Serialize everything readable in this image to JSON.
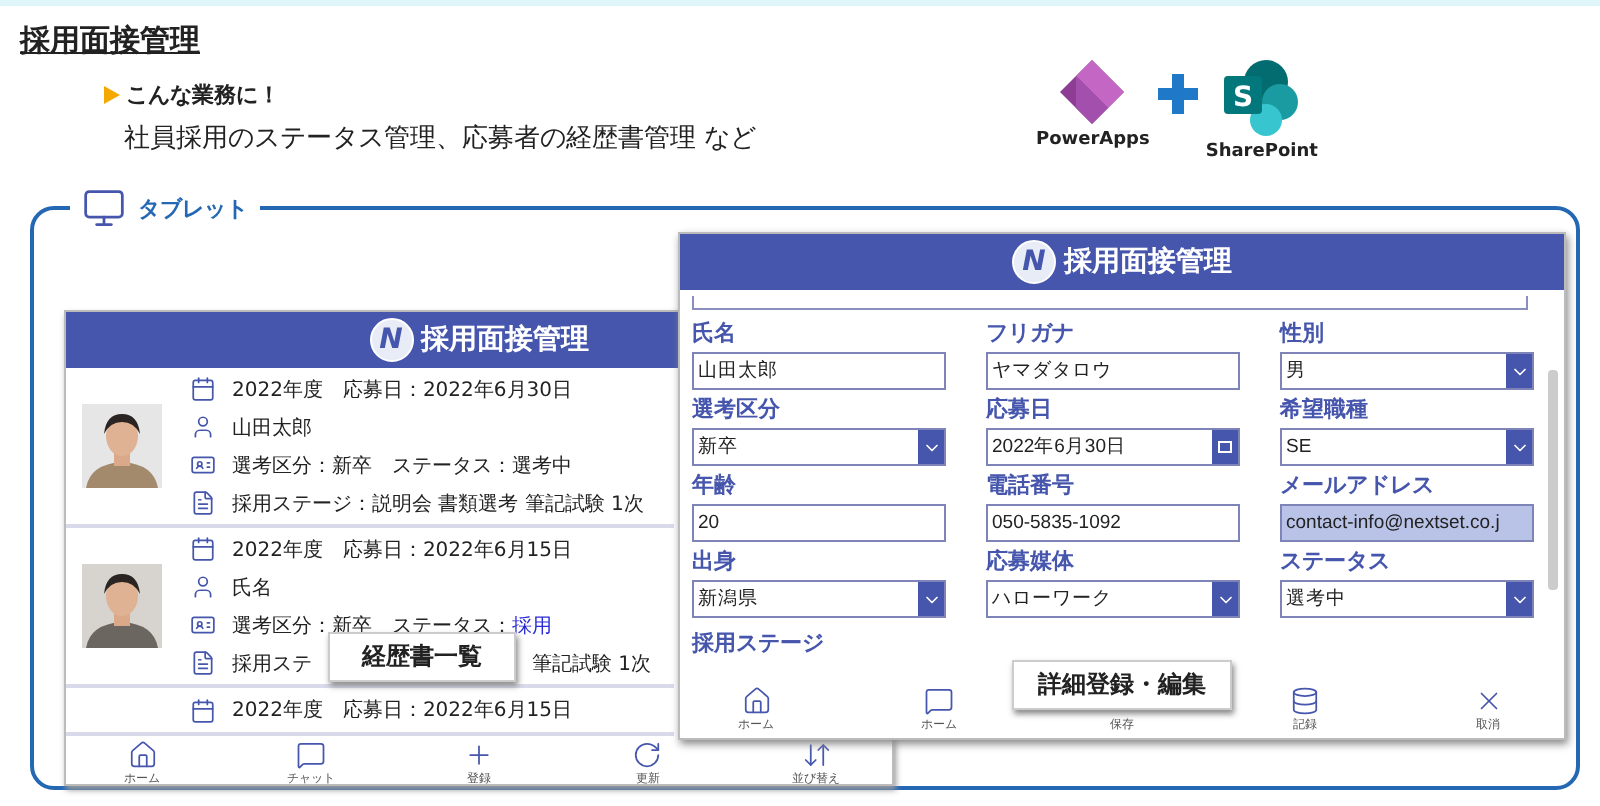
{
  "title": "採用面接管理",
  "intro": {
    "heading": "こんな業務に！",
    "text": "社員採用のステータス管理、応募者の経歴書管理 など"
  },
  "logos": [
    {
      "name": "PowerApps",
      "kind": "powerapps"
    },
    {
      "name": "SharePoint",
      "kind": "sharepoint",
      "letter": "S"
    }
  ],
  "section": {
    "label": "タブレット"
  },
  "list_screen": {
    "logo_letter": "N",
    "title": "採用面接管理",
    "callout": "経歴書一覧",
    "rows": [
      {
        "photo": {
          "kind": "picture"
        },
        "year": "2022年度　応募日：2022年6月30日",
        "name": "山田太郎",
        "category": "選考区分：新卒　ステータス：",
        "status": "選考中",
        "color": "#222222",
        "stage": [
          "採用ステージ：説明会 書類選考 筆記試験 1次"
        ]
      },
      {
        "photo": {
          "kind": "picture"
        },
        "year": "2022年度　応募日：2022年6月15日",
        "name": "氏名",
        "category": "選考区分：新卒　ステータス：",
        "status": "採用",
        "color": "#2b2bd6",
        "stage": [
          "採用ステ",
          "筆記試験 1次"
        ]
      },
      {
        "year": "2022年度　応募日：2022年6月15日"
      }
    ],
    "nav": [
      {
        "label": "ホーム",
        "kind": "home"
      },
      {
        "label": "チャット",
        "kind": "chat"
      },
      {
        "label": "登録",
        "kind": "plus"
      },
      {
        "label": "更新",
        "kind": "refresh"
      },
      {
        "label": "並び替え",
        "kind": "sort"
      }
    ]
  },
  "detail_screen": {
    "logo_letter": "N",
    "title": "採用面接管理",
    "callout": "詳細登録・編集",
    "stage_label": "採用ステージ",
    "fields": [
      {
        "label": "氏名",
        "value": "山田太郎",
        "kind": "text",
        "highlighted": false
      },
      {
        "label": "フリガナ",
        "value": "ヤマダタロウ",
        "kind": "text",
        "highlighted": false
      },
      {
        "label": "性別",
        "value": "男",
        "kind": "select",
        "highlighted": false
      },
      {
        "label": "選考区分",
        "value": "新卒",
        "kind": "select",
        "highlighted": false
      },
      {
        "label": "応募日",
        "value": "2022年6月30日",
        "kind": "date",
        "highlighted": false
      },
      {
        "label": "希望職種",
        "value": "SE",
        "kind": "select",
        "highlighted": false
      },
      {
        "label": "年齢",
        "value": "20",
        "kind": "text",
        "highlighted": false
      },
      {
        "label": "電話番号",
        "value": "050-5835-1092",
        "kind": "text",
        "highlighted": false
      },
      {
        "label": "メールアドレス",
        "value": "contact-info@nextset.co.j",
        "kind": "text",
        "highlighted": true
      },
      {
        "label": "出身",
        "value": "新潟県",
        "kind": "select",
        "highlighted": false
      },
      {
        "label": "応募媒体",
        "value": "ハローワーク",
        "kind": "select",
        "highlighted": false
      },
      {
        "label": "ステータス",
        "value": "選考中",
        "kind": "select",
        "highlighted": false
      }
    ],
    "nav": [
      {
        "label": "ホーム",
        "kind": "home"
      },
      {
        "label": "ホーム",
        "kind": "chat"
      },
      {
        "label": "保存",
        "kind": "hidden"
      },
      {
        "label": "記録",
        "kind": "database"
      },
      {
        "label": "取消",
        "kind": "close"
      }
    ]
  }
}
